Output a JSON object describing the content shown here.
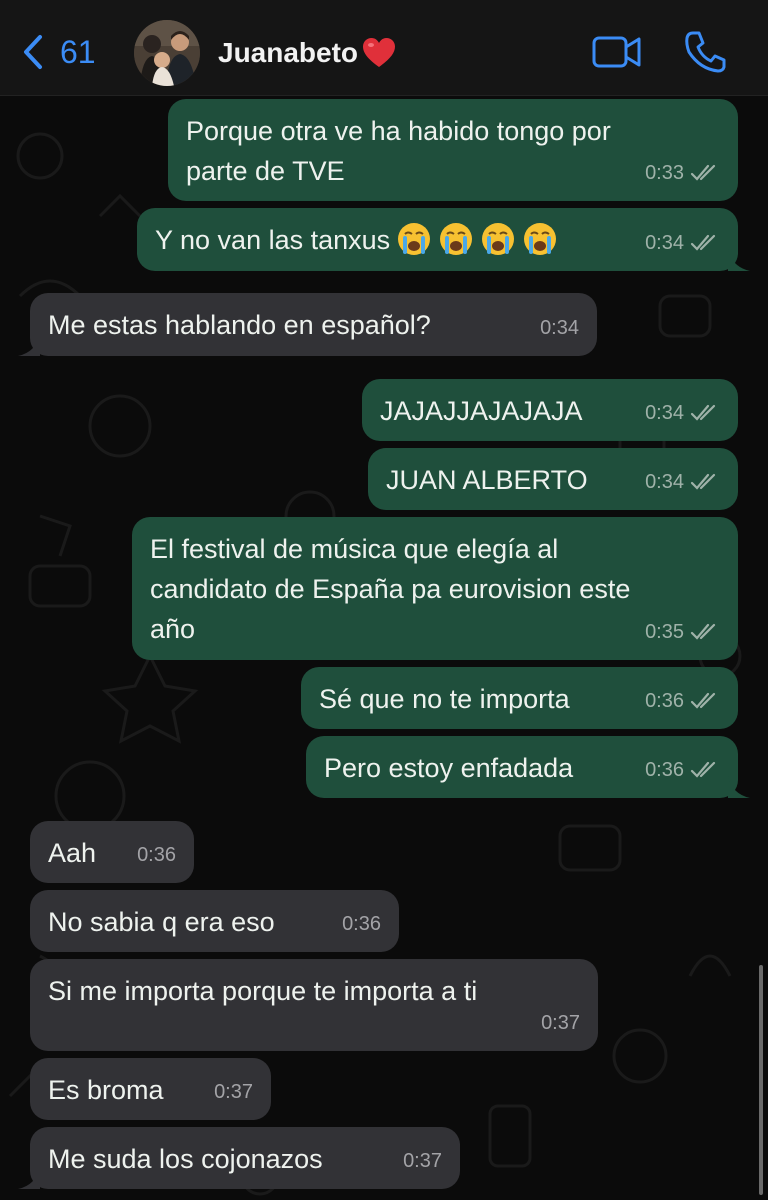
{
  "header": {
    "back_count": "61",
    "contact_name": "Juanabeto",
    "contact_emoji": "red-heart",
    "icons": {
      "back": "chevron-left-icon",
      "video": "video-camera-icon",
      "call": "phone-icon"
    }
  },
  "colors": {
    "accent": "#3b8cf5",
    "outgoing": "#1f4f3c",
    "incoming": "#323236",
    "background": "#0b0b0b"
  },
  "messages": [
    {
      "dir": "out",
      "text": "Porque otra ve ha habido tongo por\nparte de TVE",
      "time": "0:33",
      "read": true
    },
    {
      "dir": "out",
      "text": "Y no van las tanxus",
      "emojis": [
        "loudly-crying-face",
        "loudly-crying-face",
        "loudly-crying-face",
        "loudly-crying-face"
      ],
      "time": "0:34",
      "read": true
    },
    {
      "dir": "in",
      "text": "Me estas hablando en español?",
      "time": "0:34"
    },
    {
      "dir": "out",
      "text": "JAJAJJAJAJAJA",
      "time": "0:34",
      "read": true
    },
    {
      "dir": "out",
      "text": "JUAN ALBERTO",
      "time": "0:34",
      "read": true
    },
    {
      "dir": "out",
      "text": "El festival de música que elegía al\ncandidato de España pa eurovision este\naño",
      "time": "0:35",
      "read": true
    },
    {
      "dir": "out",
      "text": "Sé que no te importa",
      "time": "0:36",
      "read": true
    },
    {
      "dir": "out",
      "text": "Pero estoy enfadada",
      "time": "0:36",
      "read": true
    },
    {
      "dir": "in",
      "text": "Aah",
      "time": "0:36"
    },
    {
      "dir": "in",
      "text": "No sabia q era eso",
      "time": "0:36"
    },
    {
      "dir": "in",
      "text": "Si me importa porque te importa a ti",
      "time": "0:37"
    },
    {
      "dir": "in",
      "text": "Es broma",
      "time": "0:37"
    },
    {
      "dir": "in",
      "text": "Me suda los cojonazos",
      "time": "0:37"
    }
  ]
}
